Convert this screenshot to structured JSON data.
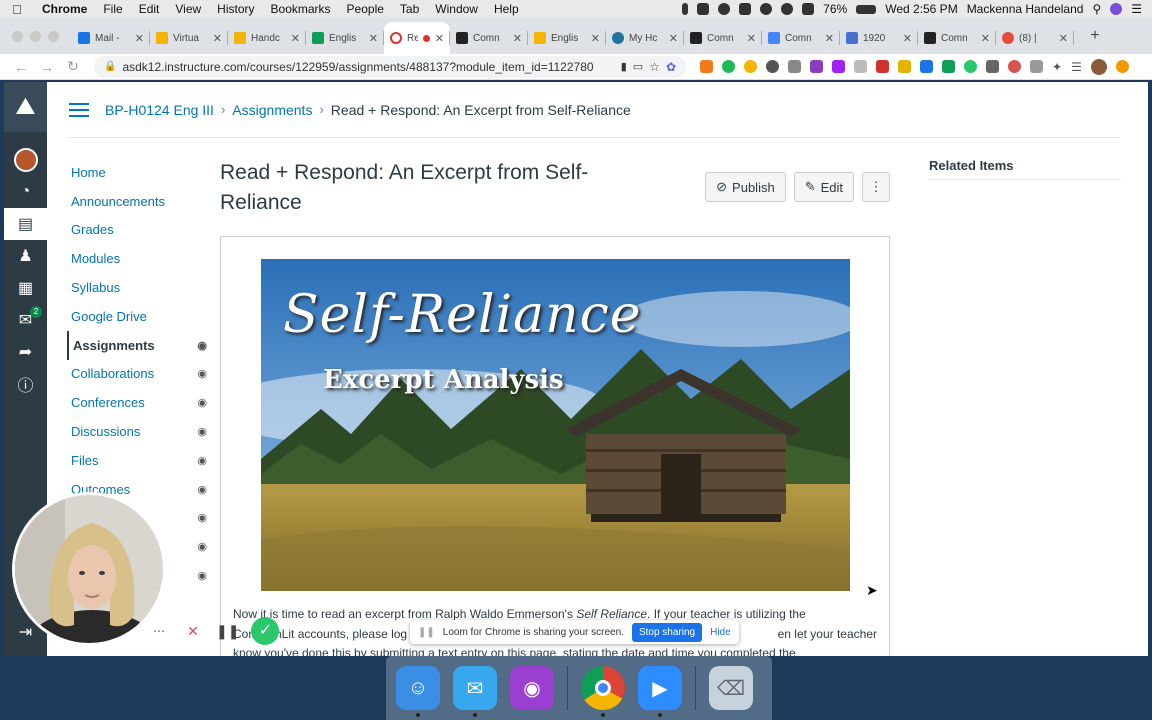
{
  "menubar": {
    "app_name": "Chrome",
    "items": [
      "File",
      "Edit",
      "View",
      "History",
      "Bookmarks",
      "People",
      "Tab",
      "Window",
      "Help"
    ],
    "battery": "76%",
    "clock": "Wed 2:56 PM",
    "user": "Mackenna Handeland"
  },
  "tabs": [
    {
      "title": "Mail -",
      "color": "#1a73e8"
    },
    {
      "title": "Virtua",
      "color": "#f4b400"
    },
    {
      "title": "Handc",
      "color": "#f4b400"
    },
    {
      "title": "Englis",
      "color": "#0f9d58"
    },
    {
      "title": "Re",
      "color": "#e0312e"
    },
    {
      "title": "Comn",
      "color": "#222222"
    },
    {
      "title": "Englis",
      "color": "#f4b400"
    },
    {
      "title": "My Hc",
      "color": "#21759b"
    },
    {
      "title": "Comn",
      "color": "#222222"
    },
    {
      "title": "Comn",
      "color": "#4285f4"
    },
    {
      "title": "1920",
      "color": "#4a6fd4"
    },
    {
      "title": "Comn",
      "color": "#222222"
    },
    {
      "title": "(8) |",
      "color": "#e34c3c"
    }
  ],
  "omnibox": {
    "url": "asdk12.instructure.com/courses/122959/assignments/488137?module_item_id=1122780"
  },
  "breadcrumb": {
    "course": "BP-H0124 Eng III",
    "section": "Assignments",
    "current": "Read + Respond: An Excerpt from Self-Reliance"
  },
  "course_nav": [
    {
      "label": "Home",
      "hidden": false
    },
    {
      "label": "Announcements",
      "hidden": false
    },
    {
      "label": "Grades",
      "hidden": false
    },
    {
      "label": "Modules",
      "hidden": false
    },
    {
      "label": "Syllabus",
      "hidden": false
    },
    {
      "label": "Google Drive",
      "hidden": false
    },
    {
      "label": "Assignments",
      "hidden": true
    },
    {
      "label": "Collaborations",
      "hidden": true
    },
    {
      "label": "Conferences",
      "hidden": true
    },
    {
      "label": "Discussions",
      "hidden": true
    },
    {
      "label": "Files",
      "hidden": true
    },
    {
      "label": "Outcomes",
      "hidden": true
    }
  ],
  "global_nav": {
    "badge_count": "2"
  },
  "assignment": {
    "title": "Read + Respond: An Excerpt from Self-Reliance",
    "publish_label": "Publish",
    "edit_label": "Edit",
    "hero_title": "Self-Reliance",
    "hero_subtitle": "Excerpt Analysis",
    "body_line1_a": "Now it is time to read an excerpt from Ralph Waldo Emmerson's ",
    "body_line1_em": "Self Reliance",
    "body_line1_b": ". If your teacher is utilizing the",
    "body_line2_a": "CommonLit accounts, please log",
    "body_line2_b": "en let your teacher",
    "body_line3": "know you've done this by submitting a text entry on this page, stating the date and time you completed the"
  },
  "related": {
    "heading": "Related Items"
  },
  "loom": {
    "share_text": "Loom for Chrome is sharing your screen.",
    "stop_label": "Stop sharing",
    "hide_label": "Hide"
  },
  "dock": [
    {
      "name": "finder",
      "color": "#3b8ee6"
    },
    {
      "name": "messages",
      "color": "#37a7f0"
    },
    {
      "name": "podcasts",
      "color": "#9b3fd0"
    },
    {
      "name": "chrome",
      "color": "#ffffff"
    },
    {
      "name": "zoom",
      "color": "#2d8cff"
    },
    {
      "name": "trash",
      "color": "#c8d2da"
    }
  ]
}
